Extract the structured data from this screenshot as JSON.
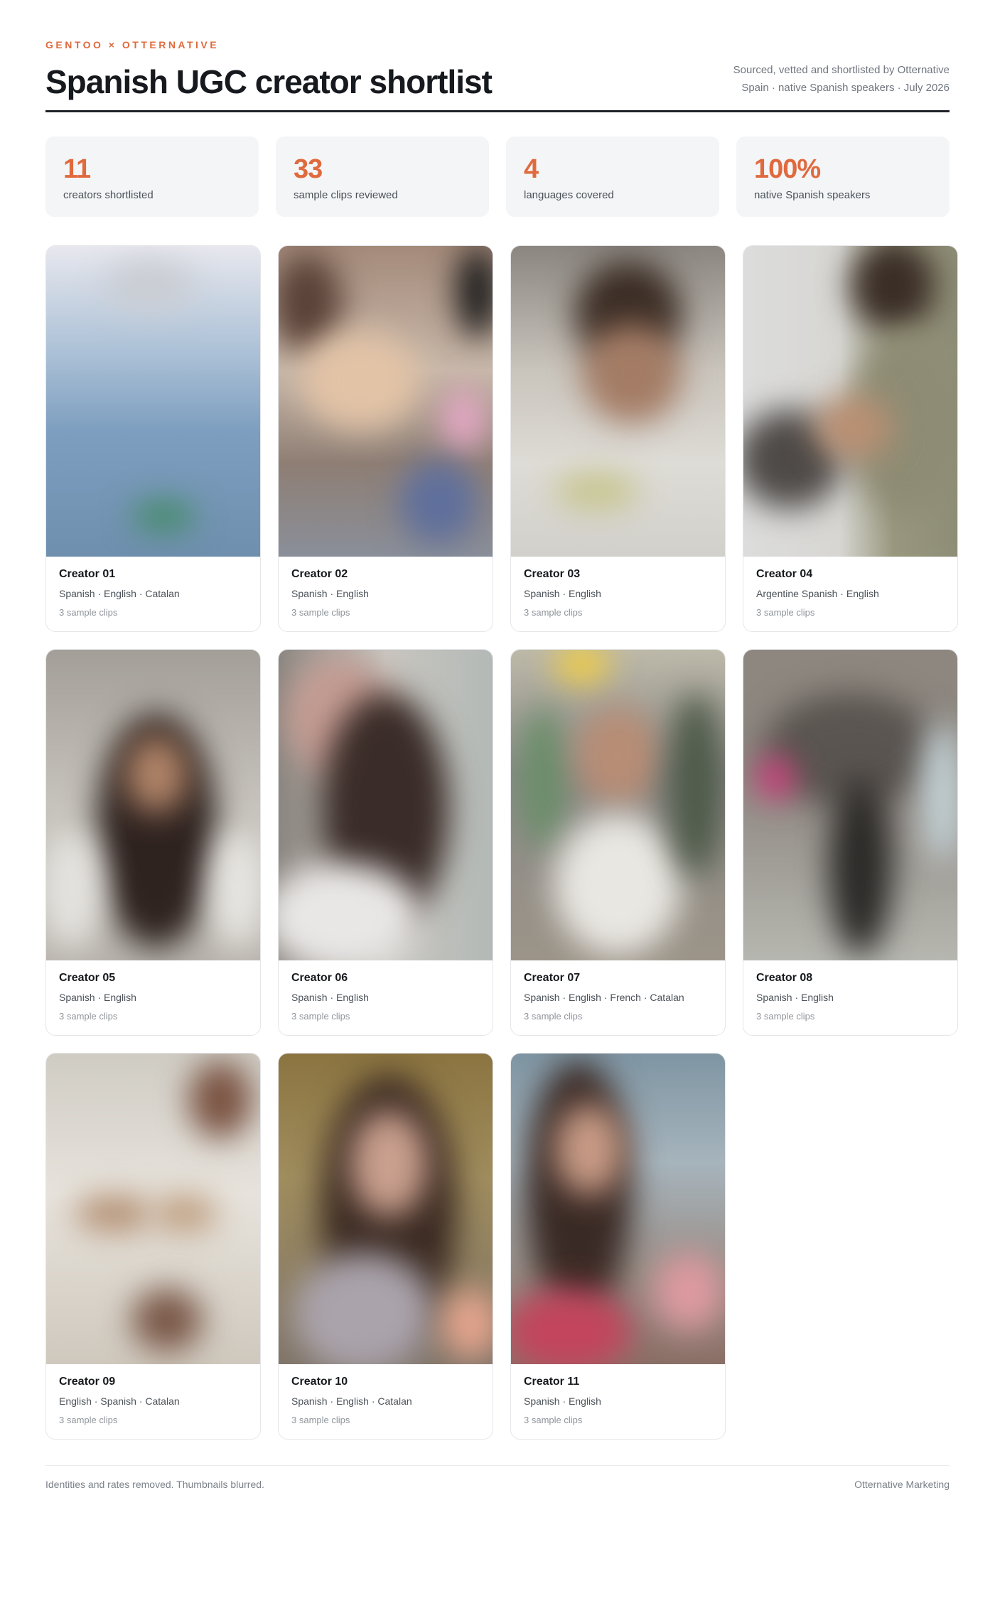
{
  "header": {
    "eyebrow": "GENTOO × OTTERNATIVE",
    "title": "Spanish UGC creator shortlist",
    "meta_line1": "Sourced, vetted and shortlisted by Otternative",
    "meta_line2": "Spain · native Spanish speakers · July 2026"
  },
  "stats": [
    {
      "value": "11",
      "label": "creators shortlisted"
    },
    {
      "value": "33",
      "label": "sample clips reviewed"
    },
    {
      "value": "4",
      "label": "languages covered"
    },
    {
      "value": "100%",
      "label": "native Spanish speakers"
    }
  ],
  "creators": [
    {
      "name": "Creator 01",
      "languages": "Spanish · English · Catalan",
      "clips": "3 sample clips"
    },
    {
      "name": "Creator 02",
      "languages": "Spanish · English",
      "clips": "3 sample clips"
    },
    {
      "name": "Creator 03",
      "languages": "Spanish · English",
      "clips": "3 sample clips"
    },
    {
      "name": "Creator 04",
      "languages": "Argentine Spanish · English",
      "clips": "3 sample clips"
    },
    {
      "name": "Creator 05",
      "languages": "Spanish · English",
      "clips": "3 sample clips"
    },
    {
      "name": "Creator 06",
      "languages": "Spanish · English",
      "clips": "3 sample clips"
    },
    {
      "name": "Creator 07",
      "languages": "Spanish · English · French · Catalan",
      "clips": "3 sample clips"
    },
    {
      "name": "Creator 08",
      "languages": "Spanish · English",
      "clips": "3 sample clips"
    },
    {
      "name": "Creator 09",
      "languages": "English · Spanish · Catalan",
      "clips": "3 sample clips"
    },
    {
      "name": "Creator 10",
      "languages": "Spanish · English · Catalan",
      "clips": "3 sample clips"
    },
    {
      "name": "Creator 11",
      "languages": "Spanish · English",
      "clips": "3 sample clips"
    }
  ],
  "footer": {
    "note": "Identities and rates removed. Thumbnails blurred.",
    "brand": "Otternative Marketing"
  },
  "colors": {
    "accent": "#e06a3e",
    "stat_bg": "#f4f5f7"
  }
}
